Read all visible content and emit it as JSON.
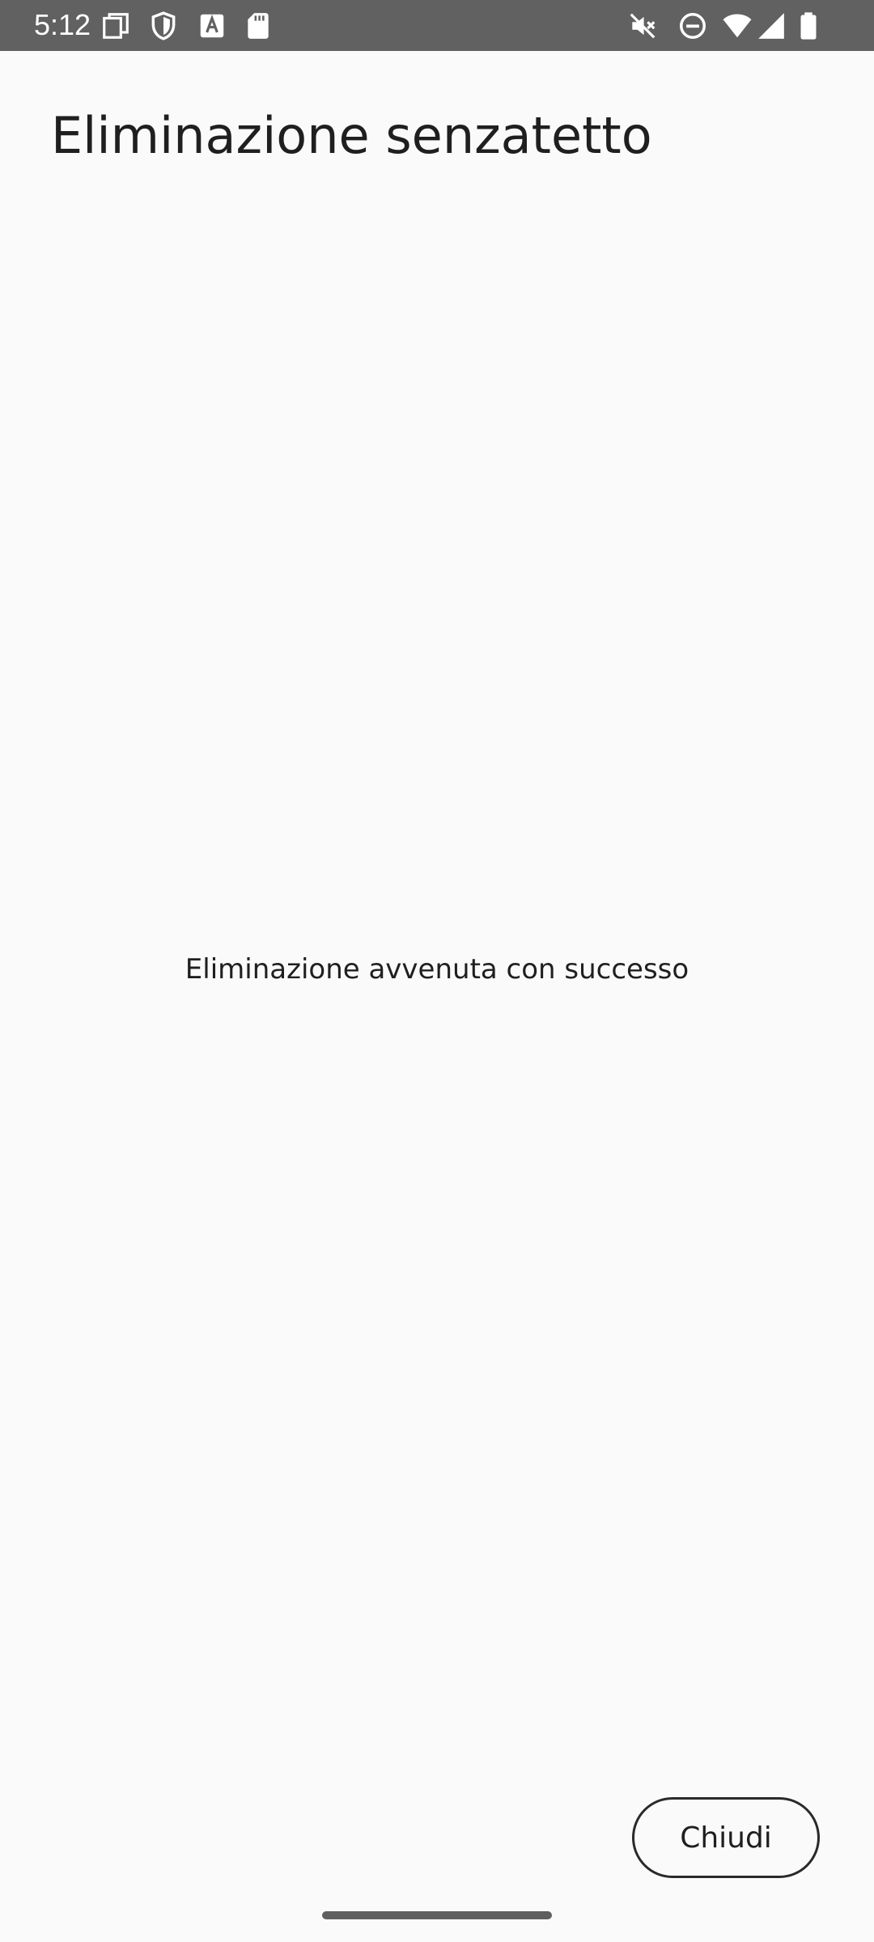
{
  "status_bar": {
    "time": "5:12",
    "background_color": "#616161",
    "left_icons": [
      "screenshot-icon",
      "shield-icon",
      "font-a-icon",
      "sd-card-icon"
    ],
    "right_icons": [
      "mute-icon",
      "do-not-disturb-icon",
      "wifi-icon",
      "cellular-signal-icon",
      "battery-icon"
    ]
  },
  "page": {
    "title": "Eliminazione senzatetto",
    "message": "Eliminazione avvenuta con successo",
    "background_color": "#FAFAFA"
  },
  "actions": {
    "close_label": "Chiudi"
  }
}
